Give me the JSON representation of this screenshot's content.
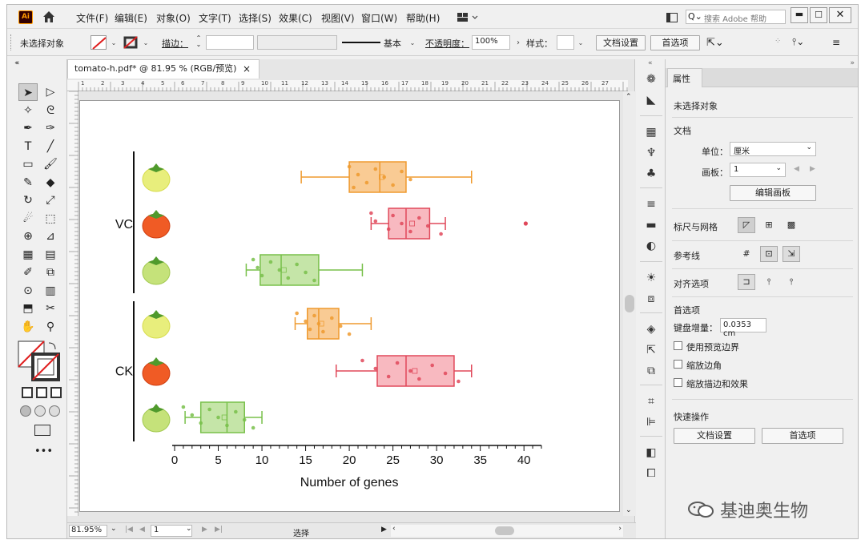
{
  "app": {
    "logo": "Ai",
    "home_icon": "home-icon"
  },
  "menu": [
    "文件(F)",
    "编辑(E)",
    "对象(O)",
    "文字(T)",
    "选择(S)",
    "效果(C)",
    "视图(V)",
    "窗口(W)",
    "帮助(H)"
  ],
  "search": {
    "placeholder": "搜索 Adobe 帮助"
  },
  "control": {
    "no_selection": "未选择对象",
    "stroke_label": "描边：",
    "stroke_style": "基本",
    "opacity_label": "不透明度：",
    "opacity_value": "100%",
    "style_label": "样式：",
    "doc_setup": "文档设置",
    "prefs": "首选项"
  },
  "tab": {
    "title": "tomato-h.pdf* @ 81.95 % (RGB/预览)",
    "close": "×"
  },
  "ruler_labels": [
    "1",
    "2",
    "3",
    "4",
    "5",
    "6",
    "7",
    "8",
    "9",
    "10",
    "11",
    "12",
    "13",
    "14",
    "15",
    "16",
    "17",
    "18",
    "19",
    "20",
    "21",
    "22",
    "23",
    "24",
    "25",
    "26",
    "27"
  ],
  "status": {
    "zoom": "81.95%",
    "page": "1",
    "mode": "选择"
  },
  "panel": {
    "title": "属性",
    "no_selection": "未选择对象",
    "doc_section": "文档",
    "unit_label": "单位：",
    "unit_value": "厘米",
    "artboard_label": "画板：",
    "artboard_value": "1",
    "edit_artboard": "编辑画板",
    "rulers_grids": "标尺与网格",
    "guides": "参考线",
    "align_options": "对齐选项",
    "prefs_section": "首选项",
    "keyboard_increment_label": "键盘增量：",
    "keyboard_increment_value": "0.0353 cm",
    "check_preview_bounds": "使用预览边界",
    "check_scale_corners": "缩放边角",
    "check_scale_strokes": "缩放描边和效果",
    "quick_actions": "快速操作",
    "doc_setup_btn": "文档设置",
    "prefs_btn": "首选项"
  },
  "chart_data": {
    "type": "boxplot",
    "xlabel": "Number of genes",
    "xlim": [
      0,
      42
    ],
    "xticks": [
      0,
      5,
      10,
      15,
      20,
      25,
      30,
      35,
      40
    ],
    "groups": [
      {
        "name": "VC",
        "rows": [
          0,
          1,
          2
        ]
      },
      {
        "name": "CK",
        "rows": [
          3,
          4,
          5
        ]
      }
    ],
    "rows": [
      {
        "tomato": "yellow",
        "color": "#ef9a2e",
        "fill": "#f9cb94",
        "min": 14.5,
        "q1": 20,
        "median": 23.5,
        "q3": 26.5,
        "max": 34,
        "mean": 23.7,
        "outliers": [],
        "points": [
          20,
          21,
          22,
          23,
          24,
          25,
          26,
          27,
          20.5
        ]
      },
      {
        "tomato": "red",
        "color": "#e0485a",
        "fill": "#f8b9c0",
        "min": 22.5,
        "q1": 24.5,
        "median": 26.5,
        "q3": 29.2,
        "max": 31,
        "mean": 27.2,
        "outliers": [
          40.2
        ],
        "points": [
          22.5,
          23,
          24.5,
          25,
          26,
          27,
          28,
          29,
          30.5
        ]
      },
      {
        "tomato": "green",
        "color": "#78c04a",
        "fill": "#c5e5a8",
        "min": 8.2,
        "q1": 9.8,
        "median": 12.2,
        "q3": 16.5,
        "max": 21.5,
        "mean": 12.5,
        "outliers": [],
        "points": [
          9,
          9.5,
          10,
          11,
          12,
          13,
          14,
          15,
          16
        ]
      },
      {
        "tomato": "yellow",
        "color": "#ef9a2e",
        "fill": "#f9cb94",
        "min": 13.8,
        "q1": 15.2,
        "median": 16.5,
        "q3": 18.8,
        "max": 22.5,
        "mean": 16.8,
        "outliers": [],
        "points": [
          14,
          15,
          15.5,
          16,
          16.5,
          17,
          18,
          19,
          20
        ]
      },
      {
        "tomato": "red",
        "color": "#e0485a",
        "fill": "#f8b9c0",
        "min": 18.5,
        "q1": 23.2,
        "median": 26.5,
        "q3": 32,
        "max": 34,
        "mean": 27.5,
        "outliers": [],
        "points": [
          21.5,
          23,
          24.5,
          25.5,
          27,
          28,
          29.5,
          31,
          32.5
        ]
      },
      {
        "tomato": "green",
        "color": "#78c04a",
        "fill": "#c5e5a8",
        "min": 1.2,
        "q1": 3,
        "median": 6,
        "q3": 8,
        "max": 10,
        "mean": 5.7,
        "outliers": [],
        "points": [
          1,
          2,
          3,
          4,
          5,
          6,
          7,
          8,
          9
        ]
      }
    ]
  },
  "watermark": "基迪奥生物"
}
